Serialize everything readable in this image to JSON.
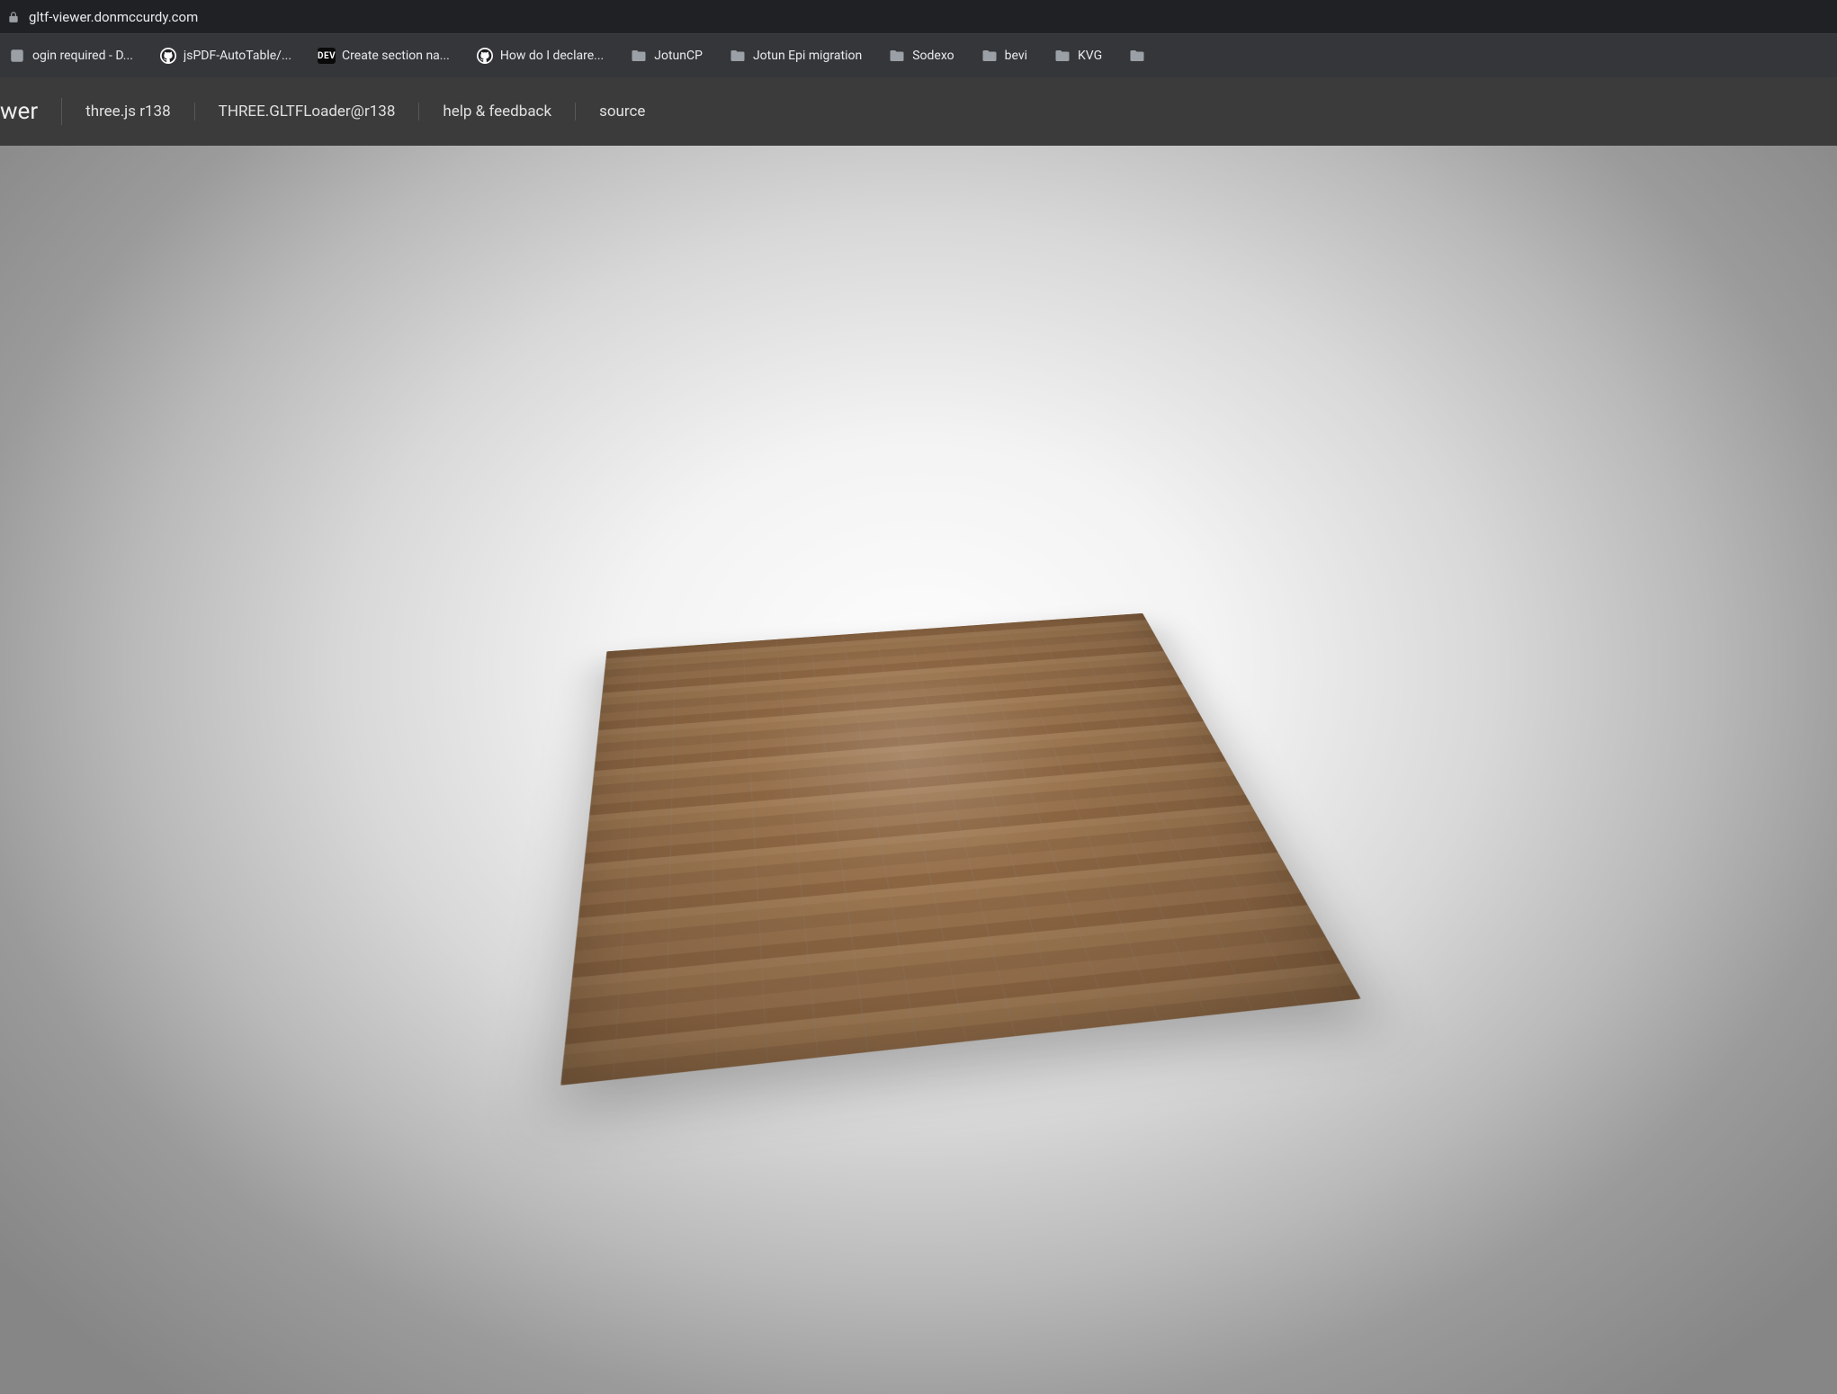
{
  "browser": {
    "url": "gltf-viewer.donmccurdy.com"
  },
  "bookmarks": [
    {
      "icon": "generic",
      "label": "ogin required - D..."
    },
    {
      "icon": "github",
      "label": "jsPDF-AutoTable/..."
    },
    {
      "icon": "dev",
      "label": "Create section na..."
    },
    {
      "icon": "github",
      "label": "How do I declare..."
    },
    {
      "icon": "folder",
      "label": "JotunCP"
    },
    {
      "icon": "folder",
      "label": "Jotun Epi migration"
    },
    {
      "icon": "folder",
      "label": "Sodexo"
    },
    {
      "icon": "folder",
      "label": "bevi"
    },
    {
      "icon": "folder",
      "label": "KVG"
    },
    {
      "icon": "folder",
      "label": ""
    }
  ],
  "header": {
    "title_fragment": "wer",
    "links": [
      "three.js r138",
      "THREE.GLTFLoader@r138",
      "help & feedback",
      "source"
    ]
  }
}
